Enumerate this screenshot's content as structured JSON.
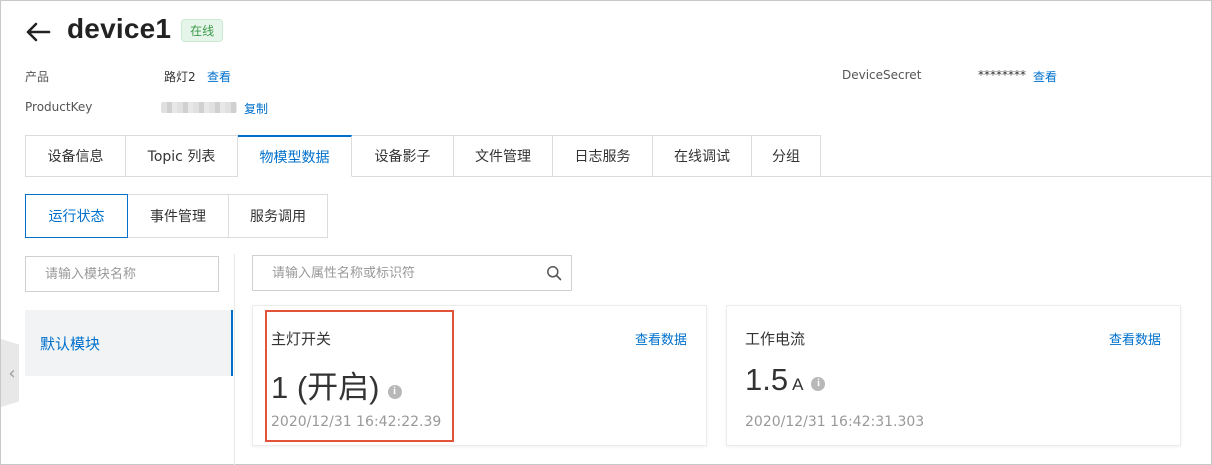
{
  "header": {
    "title": "device1",
    "status": "在线"
  },
  "info": {
    "product_label": "产品",
    "product_value": "路灯2",
    "product_link": "查看",
    "productkey_label": "ProductKey",
    "productkey_link": "复制",
    "secret_label": "DeviceSecret",
    "secret_value": "********",
    "secret_link": "查看"
  },
  "tabs": [
    "设备信息",
    "Topic 列表",
    "物模型数据",
    "设备影子",
    "文件管理",
    "日志服务",
    "在线调试",
    "分组"
  ],
  "active_tab": "物模型数据",
  "subtabs": [
    "运行状态",
    "事件管理",
    "服务调用"
  ],
  "active_subtab": "运行状态",
  "module_search": {
    "placeholder": "请输入模块名称"
  },
  "property_search": {
    "placeholder": "请输入属性名称或标识符"
  },
  "modules": [
    "默认模块"
  ],
  "properties": [
    {
      "name": "主灯开关",
      "value": "1 (开启)",
      "unit": "",
      "time": "2020/12/31 16:42:22.39",
      "link": "查看数据"
    },
    {
      "name": "工作电流",
      "value": "1.5",
      "unit": "A",
      "time": "2020/12/31 16:42:31.303",
      "link": "查看数据"
    }
  ],
  "colors": {
    "accent": "#0070cc",
    "highlight": "#e2533a",
    "status_green": "#3a9a4a"
  }
}
